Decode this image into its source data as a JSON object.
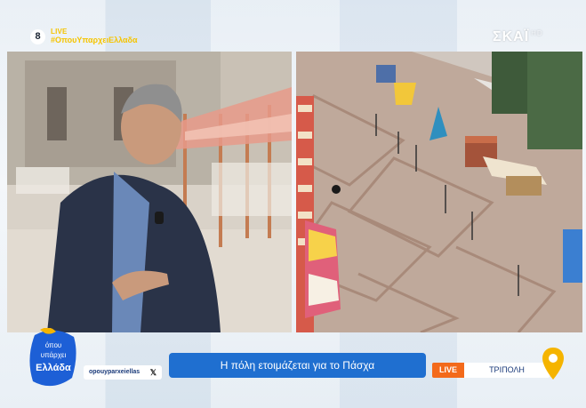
{
  "channel": {
    "number": "8",
    "live_label": "LIVE",
    "hashtag": "#ΟπουΥπαρχειΕλλαδα",
    "logo": "ΣΚΑΪ",
    "logo_suffix": "HD"
  },
  "show": {
    "brand_line1": "όπου",
    "brand_line2": "υπάρχει",
    "brand_line3": "Ελλάδα",
    "social_handle": "opouyparxeiellas",
    "social_icon": "x-icon"
  },
  "ticker": {
    "headline": "Η πόλη ετοιμάζεται για το Πάσχα",
    "live_label": "LIVE",
    "location": "ΤΡΙΠΟΛΗ",
    "location_icon": "map-pin-icon"
  },
  "colors": {
    "headline_bg": "#1f6fd0",
    "live_bg": "#f36a1b",
    "hashtag": "#f5c400",
    "pin": "#f5b400"
  }
}
